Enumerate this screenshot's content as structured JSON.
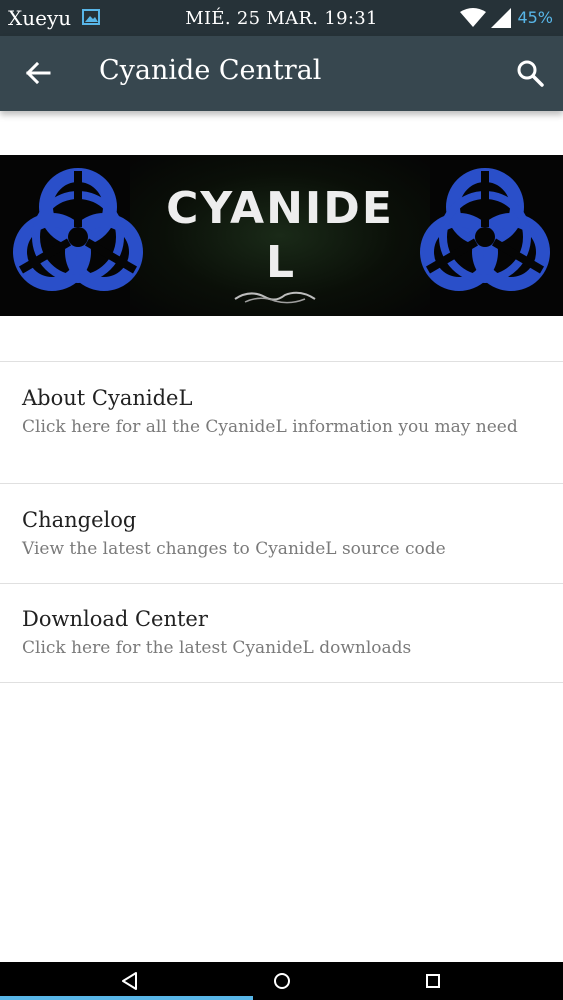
{
  "status_bar": {
    "carrier": "Xueyu",
    "datetime": "MIÉ. 25 MAR. 19:31",
    "battery": "45%",
    "icons": [
      "gallery-icon",
      "wifi-icon",
      "signal-icon"
    ]
  },
  "app_bar": {
    "title": "Cyanide Central",
    "back_icon": "arrow-left-icon",
    "search_icon": "search-icon"
  },
  "banner": {
    "line1": "CYANIDE",
    "line2": "L",
    "icons": [
      "biohazard-icon",
      "biohazard-icon"
    ]
  },
  "items": [
    {
      "title": "About CyanideL",
      "subtitle": "Click here for all the CyanideL information you may need"
    },
    {
      "title": "Changelog",
      "subtitle": "View the latest changes to CyanideL source code"
    },
    {
      "title": "Download Center",
      "subtitle": "Click here for the latest CyanideL downloads"
    }
  ],
  "colors": {
    "status_bar": "#263238",
    "app_bar": "#37474f",
    "accent": "#58b6e8",
    "biohazard": "#2a4fc9"
  },
  "nav_bar": {
    "icons": [
      "nav-back-icon",
      "nav-home-icon",
      "nav-recents-icon"
    ]
  }
}
